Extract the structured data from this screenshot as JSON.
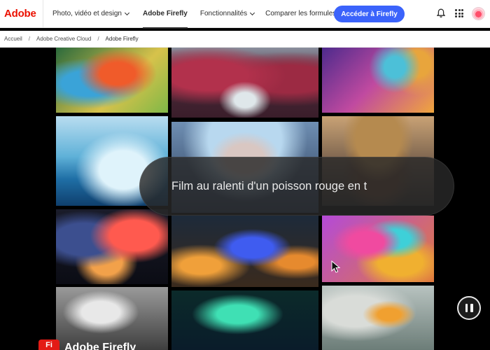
{
  "header": {
    "logo": "Adobe",
    "nav": [
      {
        "label": "Photo, vidéo et design"
      },
      {
        "label": "Adobe Firefly"
      },
      {
        "label": "Fonctionnalités"
      },
      {
        "label": "Comparer les formules"
      }
    ],
    "cta_label": "Accéder à Firefly",
    "icons": [
      "bell-icon",
      "apps-grid-icon",
      "avatar"
    ]
  },
  "breadcrumb": {
    "items": [
      "Accueil",
      "Adobe Creative Cloud",
      "Adobe Firefly"
    ],
    "separator": "/"
  },
  "hero": {
    "prompt_text": "Film au ralenti d'un poisson rouge en t",
    "controls": {
      "pause_icon": "pause-icon"
    }
  },
  "footer_product": {
    "logo": "Fi",
    "title": "Adobe Firefly"
  },
  "colors": {
    "brand_red": "#eb1000",
    "cta_blue": "#3b63fb"
  }
}
